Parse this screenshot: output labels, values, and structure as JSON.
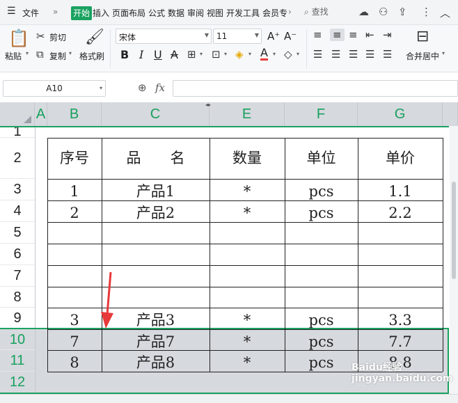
{
  "menu": {
    "file": "文件",
    "tabs": [
      "开始",
      "插入",
      "页面布局",
      "公式",
      "数据",
      "审阅",
      "视图",
      "开发工具",
      "会员专"
    ],
    "search": "查找"
  },
  "ribbon": {
    "paste": "粘贴",
    "cut": "剪切",
    "copy": "复制",
    "format_painter": "格式刷",
    "font_name": "宋体",
    "font_size": "11",
    "bold": "B",
    "italic": "I",
    "underline": "U",
    "strike": "A",
    "font_color": "A",
    "merge_center": "合并居中"
  },
  "formula_bar": {
    "name_box": "A10",
    "fx": "fx"
  },
  "columns": [
    "A",
    "B",
    "C",
    "E",
    "F",
    "G"
  ],
  "rows": [
    "1",
    "2",
    "3",
    "4",
    "5",
    "6",
    "7",
    "8",
    "9",
    "10",
    "11",
    "12"
  ],
  "selected_rows": [
    "10",
    "11",
    "12"
  ],
  "table": {
    "headers": [
      "序号",
      "品　　名",
      "数量",
      "单位",
      "单价"
    ],
    "rows": [
      [
        "1",
        "产品1",
        "*",
        "pcs",
        "1.1"
      ],
      [
        "2",
        "产品2",
        "*",
        "pcs",
        "2.2"
      ],
      [
        "3",
        "产品3",
        "*",
        "pcs",
        "3.3"
      ],
      [
        "7",
        "产品7",
        "*",
        "pcs",
        "7.7"
      ],
      [
        "8",
        "产品8",
        "*",
        "pcs",
        "8.8"
      ]
    ]
  },
  "watermark": "Baidu经验 jingyan.baidu.com",
  "colors": {
    "accent": "#1aa260",
    "selection": "#d6d9de",
    "arrow": "#e8393a"
  }
}
